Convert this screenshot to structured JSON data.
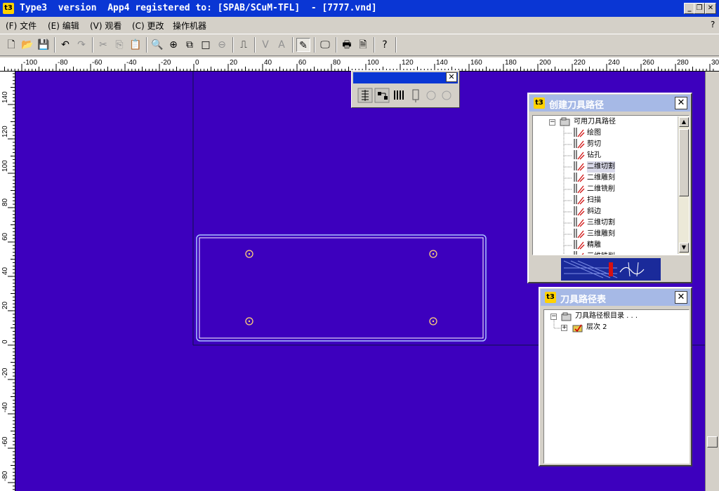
{
  "window": {
    "title": "Type3  version  App4 registered to: [SPAB/SCuM-TFL]  - [7777.vnd]",
    "app_icon": "t3-app-icon",
    "minimize_label": "_",
    "restore_label": "❐",
    "close_label": "✕"
  },
  "menu": {
    "items": [
      {
        "label": "(F) 文件"
      },
      {
        "label": "(E) 编辑"
      },
      {
        "label": "(V) 观看"
      },
      {
        "label": "(C) 更改"
      },
      {
        "label": "操作机器"
      }
    ],
    "help_label": "?"
  },
  "toolbar": {
    "buttons": [
      {
        "name": "new-file-icon",
        "glyph": "🗋"
      },
      {
        "name": "open-folder-icon",
        "glyph": "📂"
      },
      {
        "name": "save-disk-icon",
        "glyph": "💾"
      },
      {
        "name": "undo-icon",
        "glyph": "↶"
      },
      {
        "name": "redo-icon",
        "glyph": "↷",
        "disabled": true
      },
      {
        "name": "cut-icon",
        "glyph": "✂",
        "disabled": true
      },
      {
        "name": "copy-icon",
        "glyph": "⎘",
        "disabled": true
      },
      {
        "name": "paste-icon",
        "glyph": "📋",
        "disabled": true
      },
      {
        "name": "zoom-icon",
        "glyph": "🔍"
      },
      {
        "name": "zoom-in-icon",
        "glyph": "⊕"
      },
      {
        "name": "zoom-window-icon",
        "glyph": "⧉"
      },
      {
        "name": "zoom-page-icon",
        "glyph": "□"
      },
      {
        "name": "zoom-previous-icon",
        "glyph": "⊖",
        "disabled": true
      },
      {
        "name": "measure-icon",
        "glyph": "⎍"
      },
      {
        "name": "vector-icon",
        "glyph": "V",
        "disabled": true
      },
      {
        "name": "text-path-icon",
        "glyph": "A",
        "disabled": true
      },
      {
        "name": "toolpath-tool-icon",
        "glyph": "✎",
        "pressed": true
      },
      {
        "name": "display-icon",
        "glyph": "🖵"
      },
      {
        "name": "print-icon",
        "glyph": "🖶"
      },
      {
        "name": "print-preview-icon",
        "glyph": "🗎"
      },
      {
        "name": "help-icon",
        "glyph": "?"
      }
    ]
  },
  "rulers": {
    "horizontal_labels": [
      "-100",
      "-80",
      "-60",
      "-40",
      "-20",
      "0",
      "20",
      "40",
      "60",
      "80",
      "100",
      "120",
      "140",
      "160",
      "180",
      "200",
      "220",
      "240",
      "260",
      "280",
      "300"
    ],
    "vertical_labels": [
      "140",
      "120",
      "100",
      "80",
      "60",
      "40",
      "20",
      "0",
      "-20",
      "-40",
      "-60",
      "-80"
    ]
  },
  "floating_toolbar": {
    "close_label": "✕",
    "tools": [
      {
        "name": "layers-tool-icon"
      },
      {
        "name": "tree-tool-icon"
      },
      {
        "name": "multi-tool-icon"
      },
      {
        "name": "tool-holder-icon"
      },
      {
        "name": "disabled-tool-1-icon",
        "disabled": true
      },
      {
        "name": "disabled-tool-2-icon",
        "disabled": true
      }
    ]
  },
  "create_toolpath_panel": {
    "title": "创建刀具路径",
    "close_label": "✕",
    "root_label": "可用刀具路径",
    "items": [
      {
        "label": "绘图"
      },
      {
        "label": "剪切"
      },
      {
        "label": "钻孔"
      },
      {
        "label": "二维切割",
        "selected": true
      },
      {
        "label": "二维雕刻"
      },
      {
        "label": "二维铣削"
      },
      {
        "label": "扫描"
      },
      {
        "label": "斜边"
      },
      {
        "label": "三维切割"
      },
      {
        "label": "三维雕刻"
      },
      {
        "label": "精雕"
      },
      {
        "label": "三维铣削"
      }
    ]
  },
  "toolpath_list_panel": {
    "title": "刀具路径表",
    "close_label": "✕",
    "root_label": "刀具路径根目录 . . .",
    "child_label": "层次 2"
  },
  "colors": {
    "canvas": "#3d00be",
    "titlebar": "#0a36d4",
    "panel_caption": "#a6b9e6"
  }
}
